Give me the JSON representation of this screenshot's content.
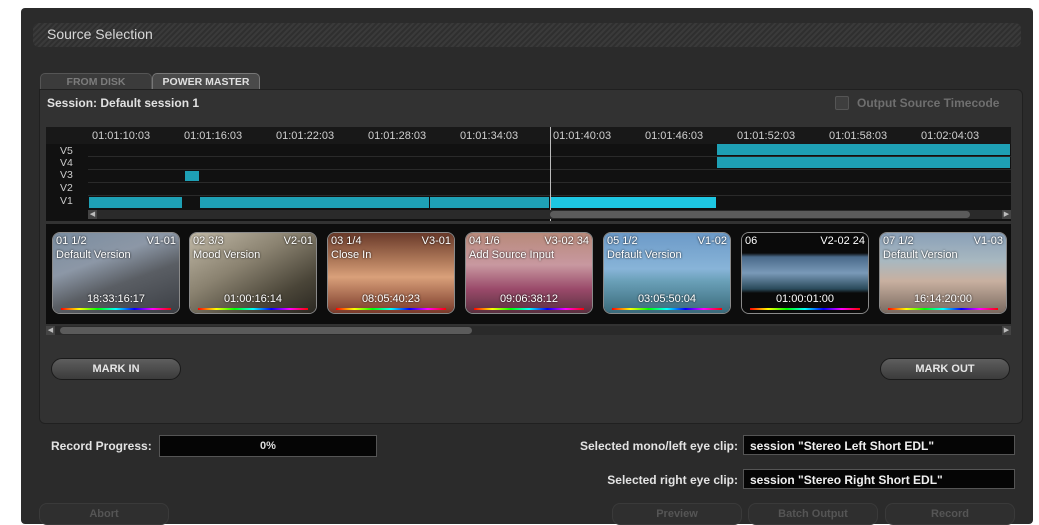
{
  "window_title": "Source Selection",
  "tabs": [
    {
      "label": "FROM DISK",
      "active": false
    },
    {
      "label": "POWER MASTER",
      "active": true
    }
  ],
  "session": {
    "label": "Session:",
    "name": "Default session 1"
  },
  "output_source_timecode": {
    "label": "Output Source Timecode",
    "checked": false
  },
  "timeline": {
    "timecodes": [
      "01:01:10:03",
      "01:01:16:03",
      "01:01:22:03",
      "01:01:28:03",
      "01:01:34:03",
      "01:01:40:03",
      "01:01:46:03",
      "01:01:52:03",
      "01:01:58:03",
      "01:02:04:03"
    ],
    "tracks": [
      "V5",
      "V4",
      "V3",
      "V2",
      "V1"
    ]
  },
  "thumbnails": [
    {
      "index": "01 1/2",
      "track": "V1-01",
      "version": "Default Version",
      "timecode": "18:33:16:17"
    },
    {
      "index": "02 3/3",
      "track": "V2-01",
      "version": "Mood Version",
      "timecode": "01:00:16:14"
    },
    {
      "index": "03 1/4",
      "track": "V3-01",
      "version": "Close In",
      "timecode": "08:05:40:23"
    },
    {
      "index": "04 1/6",
      "track": "V3-02 34",
      "version": "Add Source Input",
      "timecode": "09:06:38:12"
    },
    {
      "index": "05 1/2",
      "track": "V1-02",
      "version": "Default Version",
      "timecode": "03:05:50:04"
    },
    {
      "index": "06",
      "track": "V2-02 24",
      "version": "",
      "timecode": "01:00:01:00"
    },
    {
      "index": "07 1/2",
      "track": "V1-03",
      "version": "Default Version",
      "timecode": "16:14:20:00"
    }
  ],
  "buttons": {
    "mark_in": "MARK IN",
    "mark_out": "MARK OUT"
  },
  "record_progress": {
    "label": "Record Progress:",
    "value": "0%"
  },
  "selected_mono": {
    "label": "Selected mono/left eye clip:",
    "value": "session \"Stereo Left Short EDL\""
  },
  "selected_right": {
    "label": "Selected right eye clip:",
    "value": "session \"Stereo Right Short EDL\""
  },
  "bottom_buttons": {
    "abort": "Abort",
    "preview": "Preview",
    "batch_output": "Batch Output",
    "record": "Record"
  },
  "colors": {
    "clip": "#1ea0b5",
    "clip_selected": "#1ec7e3",
    "panel": "#2b2b2b"
  }
}
